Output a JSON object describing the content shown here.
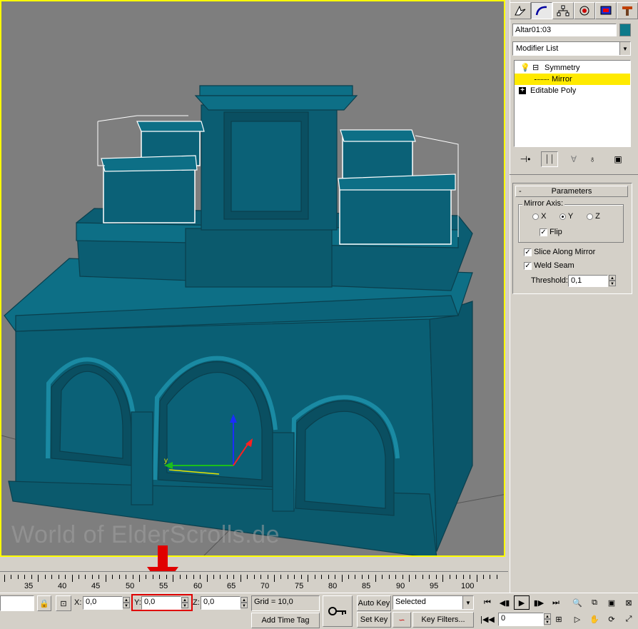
{
  "viewport": {
    "watermark": "World of ElderScrolls.de",
    "gizmo_label_y": "y",
    "border_color": "#ffff00",
    "object_color": "#0b5f73"
  },
  "command_panel": {
    "tabs": [
      "create-icon",
      "modify-icon",
      "hierarchy-icon",
      "motion-icon",
      "display-icon",
      "utilities-icon"
    ],
    "object_name": "Altar01:03",
    "object_color": "#0e7a8a",
    "modifier_list": "Modifier List",
    "stack": [
      {
        "expander": "⊟",
        "label": "Symmetry"
      },
      {
        "label": "Mirror",
        "selected": true
      },
      {
        "expander": "+",
        "label": "Editable Poly"
      }
    ],
    "stack_tools": [
      "pin-stack-icon",
      "show-end-result-icon",
      "make-unique-icon",
      "remove-modifier-icon",
      "configure-sets-icon"
    ],
    "parameters": {
      "rollout_toggle": "-",
      "title": "Parameters",
      "mirror_axis_label": "Mirror Axis:",
      "axes": [
        {
          "label": "X",
          "on": false
        },
        {
          "label": "Y",
          "on": true
        },
        {
          "label": "Z",
          "on": false
        }
      ],
      "flip": {
        "label": "Flip",
        "checked": true
      },
      "slice": {
        "label": "Slice Along Mirror",
        "checked": true
      },
      "weld": {
        "label": "Weld Seam",
        "checked": true
      },
      "threshold_label": "Threshold:",
      "threshold_value": "0,1"
    }
  },
  "timeline": {
    "ticks": [
      "35",
      "40",
      "45",
      "50",
      "55",
      "60",
      "65",
      "70",
      "75",
      "80",
      "85",
      "90",
      "95",
      "100"
    ]
  },
  "status": {
    "x_label": "X:",
    "x_value": "0,0",
    "y_label": "Y:",
    "y_value": "0,0",
    "z_label": "Z:",
    "z_value": "0,0",
    "grid": "Grid = 10,0",
    "add_time_tag": "Add Time Tag",
    "auto_key": "Auto Key",
    "set_key": "Set Key",
    "selected": "Selected",
    "key_filters": "Key Filters...",
    "frame": "0",
    "highlight_color": "#e00000"
  }
}
